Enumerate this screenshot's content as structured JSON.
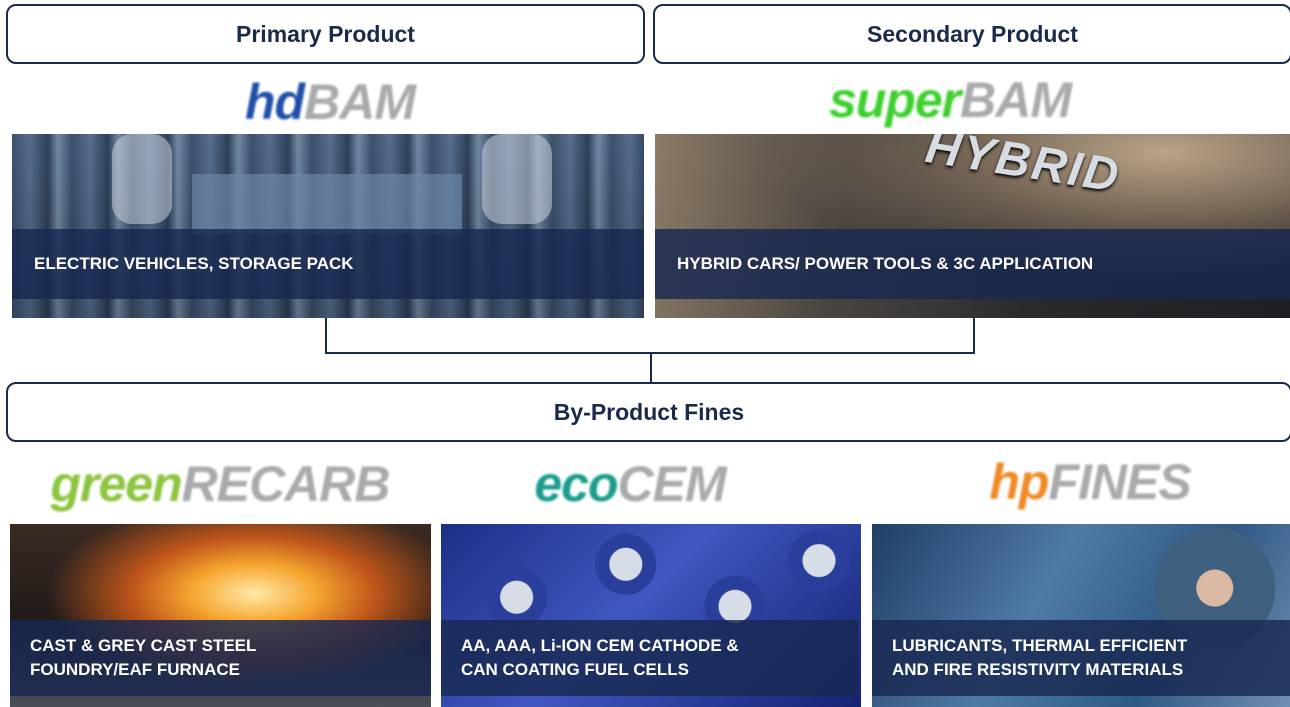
{
  "headers": {
    "primary": "Primary Product",
    "secondary": "Secondary Product",
    "byproduct": "By-Product Fines"
  },
  "logos": {
    "hd": {
      "prefix": "hd",
      "suffix": "BAM",
      "prefix_color": "#1f4fa8"
    },
    "super": {
      "prefix": "super",
      "suffix": "BAM",
      "prefix_color": "#3ecf2e"
    },
    "green": {
      "prefix": "green",
      "suffix": "RECARB",
      "prefix_color": "#8cc53f"
    },
    "eco": {
      "prefix": "eco",
      "suffix": "CEM",
      "prefix_color": "#1a9c8c"
    },
    "hp": {
      "prefix": "hp",
      "suffix": "FINES",
      "prefix_color": "#f08a24"
    }
  },
  "tiles": {
    "ev": {
      "caption": "ELECTRIC VEHICLES, STORAGE PACK",
      "image": "robotic battery assembly line"
    },
    "hybrid": {
      "caption": "HYBRID CARS/ POWER TOOLS & 3C APPLICATION",
      "image": "HYBRID car badge",
      "badge_text": "HYBRID"
    },
    "cast": {
      "caption": "CAST & GREY CAST STEEL\nFOUNDRY/EAF FURNACE",
      "image": "molten steel foundry sparks"
    },
    "battery": {
      "caption": "AA, AAA, Li-ION CEM CATHODE &\nCAN COATING  FUEL CELLS",
      "image": "AA batteries"
    },
    "lube": {
      "caption": "LUBRICANTS, THERMAL EFFICIENT\nAND FIRE RESISTIVITY MATERIALS",
      "image": "blue machined metal parts"
    }
  },
  "colors": {
    "border": "#1b2a4a",
    "band": "#182850"
  }
}
